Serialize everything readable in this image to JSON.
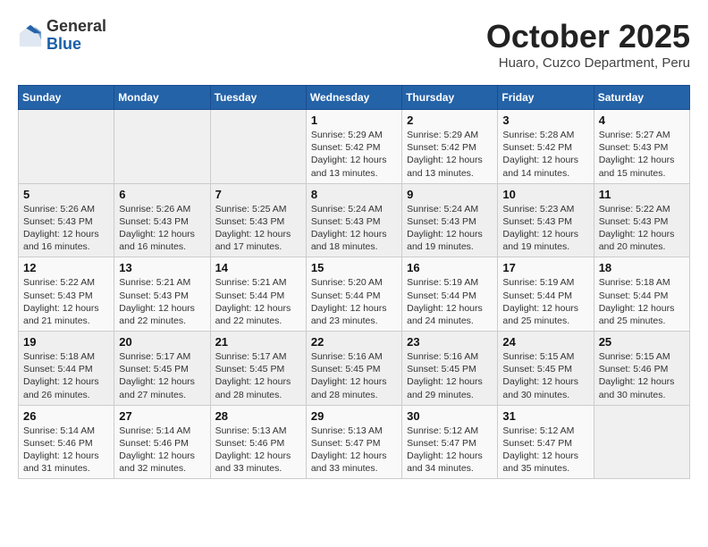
{
  "header": {
    "logo_general": "General",
    "logo_blue": "Blue",
    "month_title": "October 2025",
    "subtitle": "Huaro, Cuzco Department, Peru"
  },
  "weekdays": [
    "Sunday",
    "Monday",
    "Tuesday",
    "Wednesday",
    "Thursday",
    "Friday",
    "Saturday"
  ],
  "weeks": [
    [
      {
        "day": "",
        "sunrise": "",
        "sunset": "",
        "daylight": ""
      },
      {
        "day": "",
        "sunrise": "",
        "sunset": "",
        "daylight": ""
      },
      {
        "day": "",
        "sunrise": "",
        "sunset": "",
        "daylight": ""
      },
      {
        "day": "1",
        "sunrise": "Sunrise: 5:29 AM",
        "sunset": "Sunset: 5:42 PM",
        "daylight": "Daylight: 12 hours and 13 minutes."
      },
      {
        "day": "2",
        "sunrise": "Sunrise: 5:29 AM",
        "sunset": "Sunset: 5:42 PM",
        "daylight": "Daylight: 12 hours and 13 minutes."
      },
      {
        "day": "3",
        "sunrise": "Sunrise: 5:28 AM",
        "sunset": "Sunset: 5:42 PM",
        "daylight": "Daylight: 12 hours and 14 minutes."
      },
      {
        "day": "4",
        "sunrise": "Sunrise: 5:27 AM",
        "sunset": "Sunset: 5:43 PM",
        "daylight": "Daylight: 12 hours and 15 minutes."
      }
    ],
    [
      {
        "day": "5",
        "sunrise": "Sunrise: 5:26 AM",
        "sunset": "Sunset: 5:43 PM",
        "daylight": "Daylight: 12 hours and 16 minutes."
      },
      {
        "day": "6",
        "sunrise": "Sunrise: 5:26 AM",
        "sunset": "Sunset: 5:43 PM",
        "daylight": "Daylight: 12 hours and 16 minutes."
      },
      {
        "day": "7",
        "sunrise": "Sunrise: 5:25 AM",
        "sunset": "Sunset: 5:43 PM",
        "daylight": "Daylight: 12 hours and 17 minutes."
      },
      {
        "day": "8",
        "sunrise": "Sunrise: 5:24 AM",
        "sunset": "Sunset: 5:43 PM",
        "daylight": "Daylight: 12 hours and 18 minutes."
      },
      {
        "day": "9",
        "sunrise": "Sunrise: 5:24 AM",
        "sunset": "Sunset: 5:43 PM",
        "daylight": "Daylight: 12 hours and 19 minutes."
      },
      {
        "day": "10",
        "sunrise": "Sunrise: 5:23 AM",
        "sunset": "Sunset: 5:43 PM",
        "daylight": "Daylight: 12 hours and 19 minutes."
      },
      {
        "day": "11",
        "sunrise": "Sunrise: 5:22 AM",
        "sunset": "Sunset: 5:43 PM",
        "daylight": "Daylight: 12 hours and 20 minutes."
      }
    ],
    [
      {
        "day": "12",
        "sunrise": "Sunrise: 5:22 AM",
        "sunset": "Sunset: 5:43 PM",
        "daylight": "Daylight: 12 hours and 21 minutes."
      },
      {
        "day": "13",
        "sunrise": "Sunrise: 5:21 AM",
        "sunset": "Sunset: 5:43 PM",
        "daylight": "Daylight: 12 hours and 22 minutes."
      },
      {
        "day": "14",
        "sunrise": "Sunrise: 5:21 AM",
        "sunset": "Sunset: 5:44 PM",
        "daylight": "Daylight: 12 hours and 22 minutes."
      },
      {
        "day": "15",
        "sunrise": "Sunrise: 5:20 AM",
        "sunset": "Sunset: 5:44 PM",
        "daylight": "Daylight: 12 hours and 23 minutes."
      },
      {
        "day": "16",
        "sunrise": "Sunrise: 5:19 AM",
        "sunset": "Sunset: 5:44 PM",
        "daylight": "Daylight: 12 hours and 24 minutes."
      },
      {
        "day": "17",
        "sunrise": "Sunrise: 5:19 AM",
        "sunset": "Sunset: 5:44 PM",
        "daylight": "Daylight: 12 hours and 25 minutes."
      },
      {
        "day": "18",
        "sunrise": "Sunrise: 5:18 AM",
        "sunset": "Sunset: 5:44 PM",
        "daylight": "Daylight: 12 hours and 25 minutes."
      }
    ],
    [
      {
        "day": "19",
        "sunrise": "Sunrise: 5:18 AM",
        "sunset": "Sunset: 5:44 PM",
        "daylight": "Daylight: 12 hours and 26 minutes."
      },
      {
        "day": "20",
        "sunrise": "Sunrise: 5:17 AM",
        "sunset": "Sunset: 5:45 PM",
        "daylight": "Daylight: 12 hours and 27 minutes."
      },
      {
        "day": "21",
        "sunrise": "Sunrise: 5:17 AM",
        "sunset": "Sunset: 5:45 PM",
        "daylight": "Daylight: 12 hours and 28 minutes."
      },
      {
        "day": "22",
        "sunrise": "Sunrise: 5:16 AM",
        "sunset": "Sunset: 5:45 PM",
        "daylight": "Daylight: 12 hours and 28 minutes."
      },
      {
        "day": "23",
        "sunrise": "Sunrise: 5:16 AM",
        "sunset": "Sunset: 5:45 PM",
        "daylight": "Daylight: 12 hours and 29 minutes."
      },
      {
        "day": "24",
        "sunrise": "Sunrise: 5:15 AM",
        "sunset": "Sunset: 5:45 PM",
        "daylight": "Daylight: 12 hours and 30 minutes."
      },
      {
        "day": "25",
        "sunrise": "Sunrise: 5:15 AM",
        "sunset": "Sunset: 5:46 PM",
        "daylight": "Daylight: 12 hours and 30 minutes."
      }
    ],
    [
      {
        "day": "26",
        "sunrise": "Sunrise: 5:14 AM",
        "sunset": "Sunset: 5:46 PM",
        "daylight": "Daylight: 12 hours and 31 minutes."
      },
      {
        "day": "27",
        "sunrise": "Sunrise: 5:14 AM",
        "sunset": "Sunset: 5:46 PM",
        "daylight": "Daylight: 12 hours and 32 minutes."
      },
      {
        "day": "28",
        "sunrise": "Sunrise: 5:13 AM",
        "sunset": "Sunset: 5:46 PM",
        "daylight": "Daylight: 12 hours and 33 minutes."
      },
      {
        "day": "29",
        "sunrise": "Sunrise: 5:13 AM",
        "sunset": "Sunset: 5:47 PM",
        "daylight": "Daylight: 12 hours and 33 minutes."
      },
      {
        "day": "30",
        "sunrise": "Sunrise: 5:12 AM",
        "sunset": "Sunset: 5:47 PM",
        "daylight": "Daylight: 12 hours and 34 minutes."
      },
      {
        "day": "31",
        "sunrise": "Sunrise: 5:12 AM",
        "sunset": "Sunset: 5:47 PM",
        "daylight": "Daylight: 12 hours and 35 minutes."
      },
      {
        "day": "",
        "sunrise": "",
        "sunset": "",
        "daylight": ""
      }
    ]
  ]
}
